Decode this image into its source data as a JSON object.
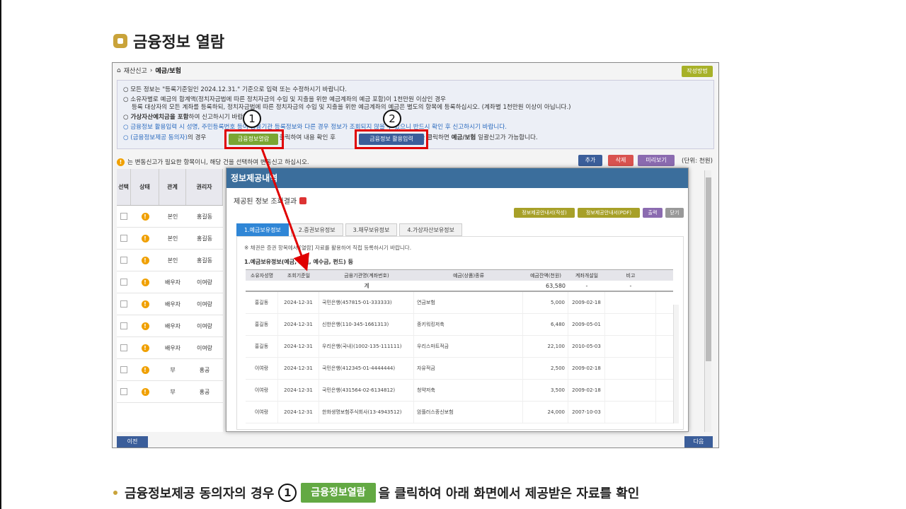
{
  "heading": "금융정보 열람",
  "shot": {
    "breadcrumb": {
      "root": "재산신고",
      "current": "예금/보험"
    },
    "guide_button": "작성방법",
    "notice": {
      "l1": "○ 모든 정보는 \"등록기준일인 2024.12.31.\" 기준으로 입력 또는 수정하시기 바랍니다.",
      "l2": "○ 소유자별로 예금의 합계액(정치자금법에 따른 정치자금의 수입 및 지출을 위한 예금계좌의 예금 포함)이 1천만원 이상인 경우",
      "l3": "등록 대상자의 모든 계좌를 등록하되, 정치자금법에 따른 정치자금의 수입 및 지출을 위한 예금계좌의 예금은 별도의 항목에 등록하십시오. (계좌별 1천만원 이상이 아닙니다.)",
      "l4a": "○ 가상자산예치금을 포함",
      "l4b": "하여 신고하시기 바랍니다.",
      "l5": "○ 금융정보 활용입력 시 성명, 주민등록번호 등이 금융기관 등록정보와 다른 경우 정보가 조회되지 않을 수 있으니 반드시 확인 후 신고하시기 바랍니다.",
      "l6a": "○ (금융정보제공 동의자)",
      "l6b": "의 경우",
      "l6c": "를 클릭하여 내용 확인 후",
      "l6d": "버튼을 클릭하면",
      "l6e": "예금/보험",
      "l6f": "일괄신고가 가능합니다."
    },
    "btn_view": "금융정보열람",
    "btn_use": "금융정보 활용입력",
    "marker1": "1",
    "marker2": "2",
    "warn_text": "는 변동신고가 필요한 항목이니, 해당 건을 선택하여 변동신고 하십시오.",
    "toolbar": {
      "add": "추가",
      "delete": "삭제",
      "preview": "미리보기",
      "unit": "(단위: 천원)"
    },
    "left_table": {
      "headers": [
        "선택",
        "상태",
        "관계",
        "권리자"
      ],
      "rows": [
        {
          "rel": "본인",
          "name": "홍길동"
        },
        {
          "rel": "본인",
          "name": "홍길동"
        },
        {
          "rel": "본인",
          "name": "홍길동"
        },
        {
          "rel": "배우자",
          "name": "이여랑"
        },
        {
          "rel": "배우자",
          "name": "이여랑"
        },
        {
          "rel": "배우자",
          "name": "이여랑"
        },
        {
          "rel": "배우자",
          "name": "이여랑"
        },
        {
          "rel": "부",
          "name": "홍공"
        },
        {
          "rel": "부",
          "name": "홍공"
        }
      ]
    },
    "prev": "이전",
    "next": "다음"
  },
  "modal": {
    "title": "정보제공내역",
    "subtitle": "제공된 정보 조회결과",
    "buttons": {
      "print_ko": "정보제공안내서(작성)",
      "print_pdf": "정보제공안내서(PDF)",
      "print": "출력",
      "close": "닫기"
    },
    "tabs": [
      "1.예금보유정보",
      "2.증권보유정보",
      "3.채무보유정보",
      "4.가상자산보유정보"
    ],
    "note": "※ 채권은 증권 항목에서 [열람] 자료를 활용하여 직접 등록하시기 바랍니다.",
    "section": "1.예금보유정보(예금, 보험, 예수금, 펀드) 등",
    "columns": [
      "소유자성명",
      "조회기준일",
      "금융기관명(계좌번호)",
      "예금(상품)종류",
      "예금잔액(천원)",
      "계좌개설일",
      "비고"
    ],
    "sum": {
      "label": "계",
      "amount": "63,580",
      "date": "-",
      "note": "-"
    },
    "rows": [
      {
        "owner": "홍길동",
        "date": "2024-12-31",
        "inst": "국민은행(457815-01-333333)",
        "kind": "연금보험",
        "amt": "5,000",
        "open": "2009-02-18"
      },
      {
        "owner": "홍길동",
        "date": "2024-12-31",
        "inst": "신한은행(110-345-1661313)",
        "kind": "종키워킹저축",
        "amt": "6,480",
        "open": "2009-05-01"
      },
      {
        "owner": "홍길동",
        "date": "2024-12-31",
        "inst": "우리은행(국내)(1002-135-111111)",
        "kind": "우리스마트적금",
        "amt": "22,100",
        "open": "2010-05-03"
      },
      {
        "owner": "이여랑",
        "date": "2024-12-31",
        "inst": "국민은행(412345-01-4444444)",
        "kind": "자유적금",
        "amt": "2,500",
        "open": "2009-02-18"
      },
      {
        "owner": "이여랑",
        "date": "2024-12-31",
        "inst": "국민은행(431564-02-6134812)",
        "kind": "청약저축",
        "amt": "3,500",
        "open": "2009-02-18"
      },
      {
        "owner": "이여랑",
        "date": "2024-12-31",
        "inst": "한화생명보험주식회사(13-4943512)",
        "kind": "암플러스종신보험",
        "amt": "24,000",
        "open": "2007-10-03"
      }
    ]
  },
  "caption": {
    "pre": "금융정보제공 동의자의 경우",
    "num": "1",
    "btn": "금융정보열람",
    "post": "을 클릭하여 아래 화면에서 제공받은 자료를 확인"
  }
}
